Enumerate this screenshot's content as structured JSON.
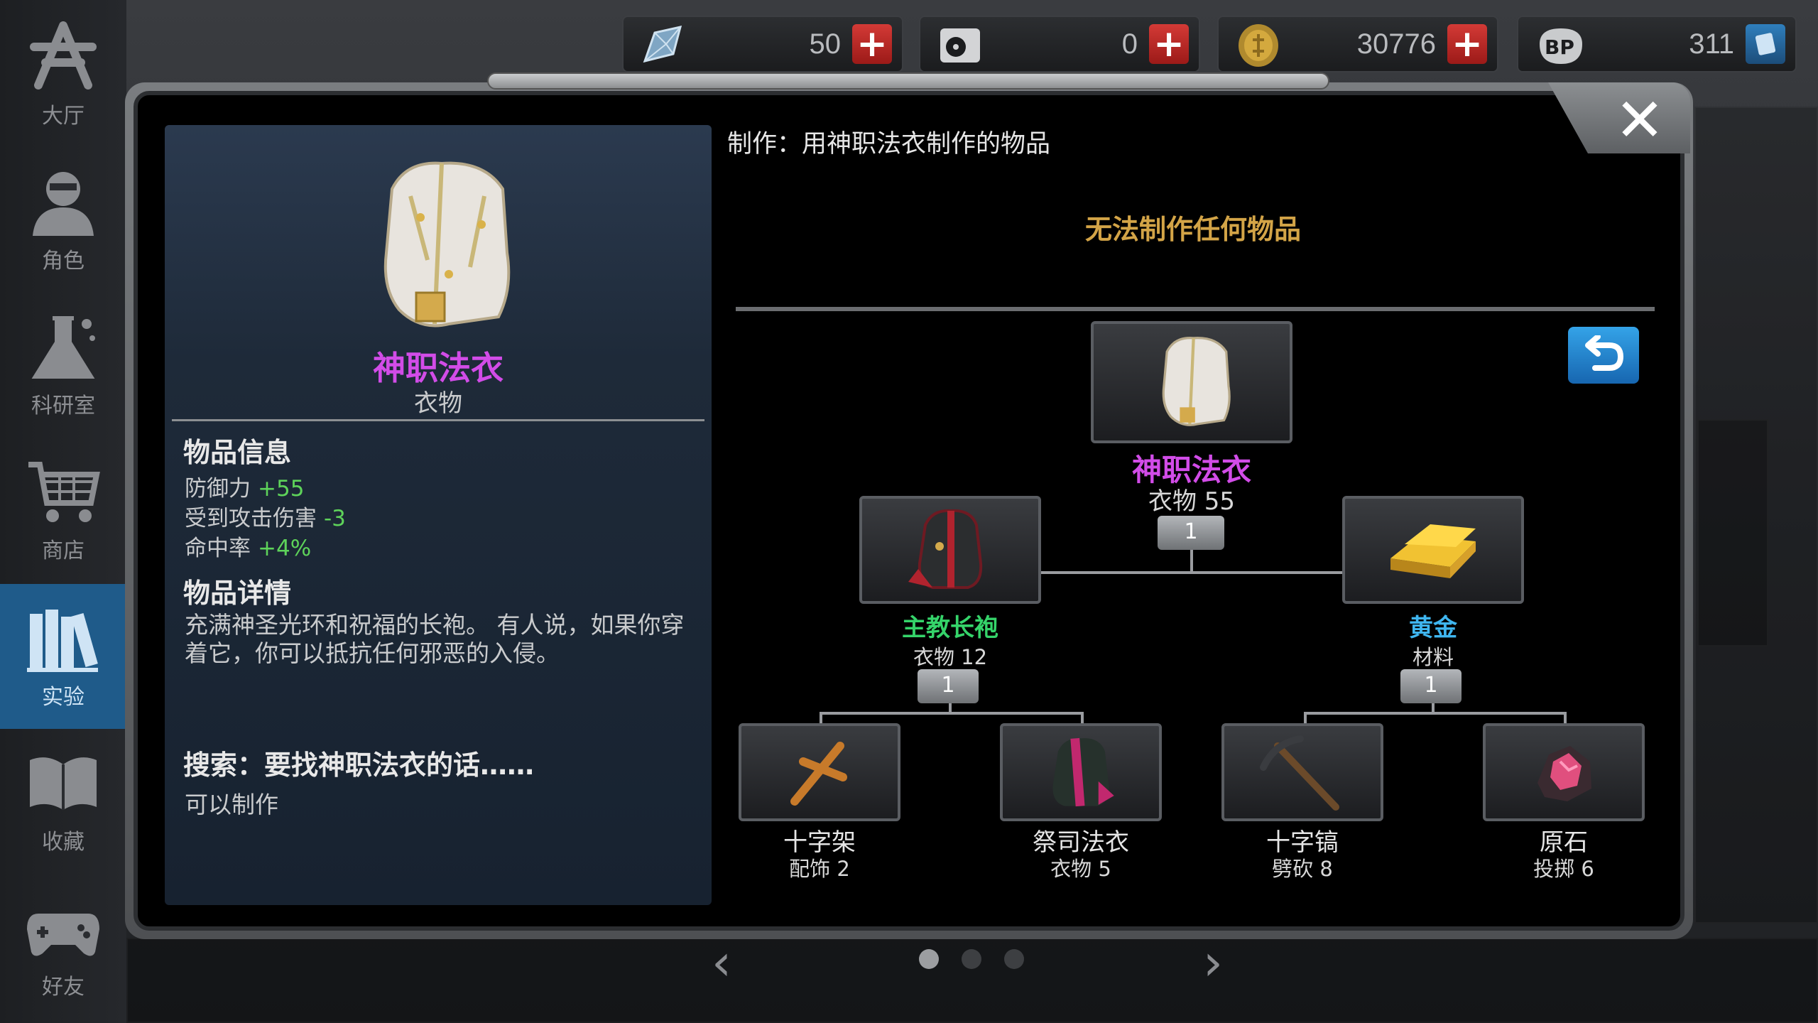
{
  "sidebar": {
    "items": [
      {
        "label": "大厅",
        "icon": "lobby-icon",
        "active": false
      },
      {
        "label": "角色",
        "icon": "character-icon",
        "active": false
      },
      {
        "label": "科研室",
        "icon": "lab-flask-icon",
        "active": false
      },
      {
        "label": "商店",
        "icon": "shop-cart-icon",
        "active": false
      },
      {
        "label": "实验",
        "icon": "books-icon",
        "active": true
      },
      {
        "label": "收藏",
        "icon": "book-open-icon",
        "active": false
      },
      {
        "label": "好友",
        "icon": "gamepad-icon",
        "active": false
      }
    ]
  },
  "resources": [
    {
      "icon": "crystal-icon",
      "value": "50",
      "button": "plus-icon"
    },
    {
      "icon": "disk-icon",
      "value": "0",
      "button": "plus-icon"
    },
    {
      "icon": "gold-coin-icon",
      "value": "30776",
      "button": "plus-icon"
    },
    {
      "icon": "bp-paw-icon",
      "value": "311",
      "button": "card-icon"
    }
  ],
  "item": {
    "name": "神职法衣",
    "type": "衣物",
    "info_title": "物品信息",
    "stats": [
      {
        "label": "防御力",
        "value": "+55"
      },
      {
        "label": "受到攻击伤害",
        "value": "-3"
      },
      {
        "label": "命中率",
        "value": "+4%"
      }
    ],
    "details_title": "物品详情",
    "description": "充满神圣光环和祝福的长袍。 有人说，如果你穿着它，你可以抵抗任何邪恶的入侵。",
    "search_title": "搜索：要找神职法衣的话……",
    "search_result": "可以制作"
  },
  "crafting": {
    "title": "制作：用神职法衣制作的物品",
    "empty_message": "无法制作任何物品"
  },
  "recipe": {
    "root": {
      "name": "神职法衣",
      "sub": "衣物 55",
      "count": "1",
      "color": "#d24ce8"
    },
    "left": {
      "name": "主教长袍",
      "sub": "衣物 12",
      "count": "1",
      "color": "#35d46a"
    },
    "right": {
      "name": "黄金",
      "sub": "材料",
      "count": "1",
      "color": "#3fb6f0"
    },
    "leaves": [
      {
        "name": "十字架",
        "sub": "配饰 2"
      },
      {
        "name": "祭司法衣",
        "sub": "衣物 5"
      },
      {
        "name": "十字镐",
        "sub": "劈砍 8"
      },
      {
        "name": "原石",
        "sub": "投掷 6"
      }
    ]
  },
  "pagination": {
    "pages": 3,
    "current": 1
  }
}
